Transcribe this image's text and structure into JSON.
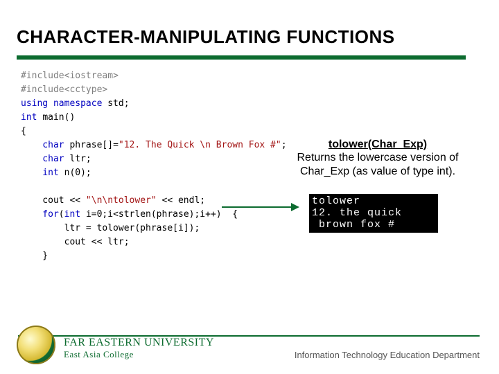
{
  "heading": "CHARACTER-MANIPULATING FUNCTIONS",
  "code": {
    "l1a": "#include",
    "l1b": "<iostream>",
    "l2a": "#include",
    "l2b": "<cctype>",
    "l3a": "using namespace ",
    "l3b": "std;",
    "l4a": "int ",
    "l4b": "main()",
    "l5": "{",
    "l6a": "    char ",
    "l6b": "phrase[]=",
    "l6c": "\"12. The Quick \\n Brown Fox #\"",
    "l6d": ";",
    "l7a": "    char ",
    "l7b": "ltr;",
    "l8a": "    int ",
    "l8b": "n(0);",
    "l9": "",
    "l10a": "    cout << ",
    "l10b": "\"\\n\\ntolower\"",
    "l10c": " << endl;",
    "l11a": "    for",
    "l11b": "(",
    "l11c": "int ",
    "l11d": "i=0;i<strlen(phrase);i++)  {",
    "l12": "        ltr = tolower(phrase[i]);",
    "l13": "        cout << ltr;",
    "l14": "    }"
  },
  "callout": {
    "title": "tolower(Char_Exp)",
    "body": "Returns the lowercase version of Char_Exp (as value of type int)."
  },
  "console": {
    "line1": "tolower",
    "line2": "12. the quick",
    "line3": " brown fox #"
  },
  "footer": {
    "institution1": "FAR EASTERN UNIVERSITY",
    "institution2": "East Asia College",
    "department": "Information Technology Education Department"
  }
}
